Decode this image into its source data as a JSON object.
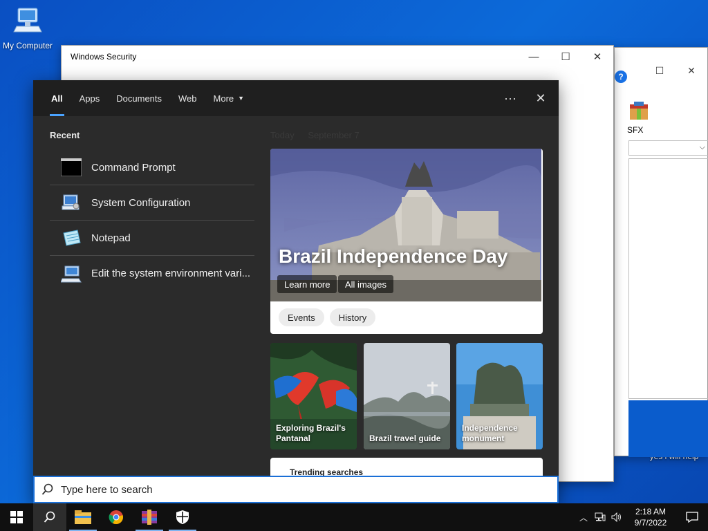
{
  "desktop": {
    "my_computer_label": "My Computer",
    "recycle_label": "yes i will help"
  },
  "windows_security": {
    "title": "Windows Security"
  },
  "back_window": {
    "sfx_label": "SFX",
    "help_glyph": "?"
  },
  "search": {
    "tabs": [
      {
        "label": "All"
      },
      {
        "label": "Apps"
      },
      {
        "label": "Documents"
      },
      {
        "label": "Web"
      },
      {
        "label": "More"
      }
    ],
    "more_glyph": "···",
    "close_glyph": "✕",
    "recent_title": "Recent",
    "recent_items": [
      {
        "label": "Command Prompt",
        "icon": "command-prompt-icon"
      },
      {
        "label": "System Configuration",
        "icon": "system-configuration-icon"
      },
      {
        "label": "Notepad",
        "icon": "notepad-icon"
      },
      {
        "label": "Edit the system environment vari...",
        "icon": "system-properties-icon"
      }
    ],
    "today_label": "Today",
    "today_date": "September 7",
    "hero": {
      "title": "Brazil Independence Day",
      "learn_more": "Learn more",
      "all_images": "All images",
      "tags": [
        "Events",
        "History"
      ]
    },
    "cards": [
      {
        "caption": "Exploring Brazil's Pantanal"
      },
      {
        "caption": "Brazil travel guide"
      },
      {
        "caption": "Independence monument"
      }
    ],
    "trending_title": "Trending searches",
    "input_placeholder": "Type here to search"
  },
  "taskbar": {
    "apps": [
      "start-icon",
      "search-icon",
      "file-explorer-icon",
      "chrome-icon",
      "winrar-icon",
      "windows-security-icon"
    ],
    "time": "2:18 AM",
    "date": "9/7/2022"
  },
  "colors": {
    "accent": "#4aa3ff",
    "panel_bg": "#2b2b2b",
    "taskbar_bg": "#101010",
    "desktop_blue": "#0c6ad9"
  }
}
